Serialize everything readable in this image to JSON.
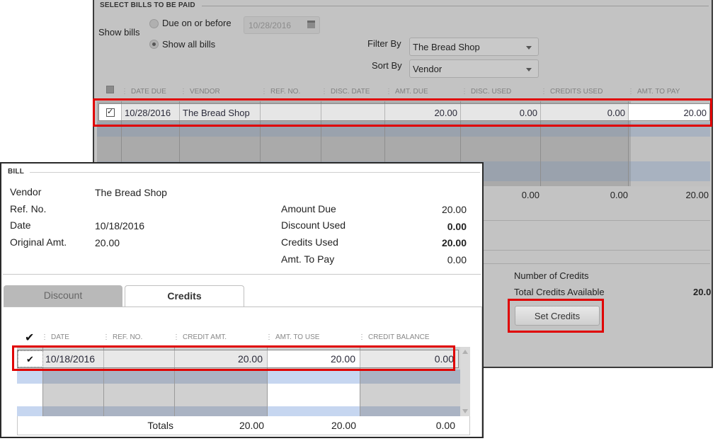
{
  "pay_bills": {
    "section_title": "SELECT BILLS TO BE PAID",
    "show_bills_label": "Show bills",
    "radio_due_label": "Due on or before",
    "radio_due_selected": false,
    "due_date_value": "10/28/2016",
    "radio_all_label": "Show all bills",
    "radio_all_selected": true,
    "filter_by_label": "Filter By",
    "filter_by_value": "The Bread Shop",
    "sort_by_label": "Sort By",
    "sort_by_value": "Vendor",
    "columns": [
      "DATE DUE",
      "VENDOR",
      "REF. NO.",
      "DISC. DATE",
      "AMT. DUE",
      "DISC. USED",
      "CREDITS USED",
      "AMT. TO PAY"
    ],
    "rows": [
      {
        "checked": true,
        "date_due": "10/28/2016",
        "vendor": "The Bread Shop",
        "ref_no": "",
        "disc_date": "",
        "amt_due": "20.00",
        "disc_used": "0.00",
        "credits_used": "0.00",
        "amt_to_pay": "20.00"
      }
    ],
    "totals": {
      "disc_used": "0.00",
      "credits_used": "0.00",
      "amt_to_pay": "20.00"
    },
    "number_of_credits_label": "Number of Credits",
    "total_credits_available_label": "Total Credits Available",
    "total_credits_available_value": "20.0",
    "set_credits_button": "Set Credits"
  },
  "bill_dialog": {
    "section_title": "BILL",
    "vendor_label": "Vendor",
    "vendor_value": "The Bread Shop",
    "ref_no_label": "Ref. No.",
    "ref_no_value": "",
    "date_label": "Date",
    "date_value": "10/18/2016",
    "original_amt_label": "Original Amt.",
    "original_amt_value": "20.00",
    "amount_due_label": "Amount Due",
    "amount_due_value": "20.00",
    "discount_used_label": "Discount Used",
    "discount_used_value": "0.00",
    "credits_used_label": "Credits Used",
    "credits_used_value": "20.00",
    "amt_to_pay_label": "Amt. To Pay",
    "amt_to_pay_value": "0.00",
    "tabs": [
      {
        "label": "Discount",
        "active": false
      },
      {
        "label": "Credits",
        "active": true
      }
    ],
    "credit_columns": [
      "DATE",
      "REF. NO.",
      "CREDIT AMT.",
      "AMT. TO USE",
      "CREDIT BALANCE"
    ],
    "credit_rows": [
      {
        "checked": true,
        "date": "10/18/2016",
        "ref_no": "",
        "credit_amt": "20.00",
        "amt_to_use": "20.00",
        "credit_balance": "0.00"
      }
    ],
    "totals_label": "Totals",
    "totals": {
      "credit_amt": "20.00",
      "amt_to_use": "20.00",
      "credit_balance": "0.00"
    }
  },
  "highlight_color": "#e00000"
}
